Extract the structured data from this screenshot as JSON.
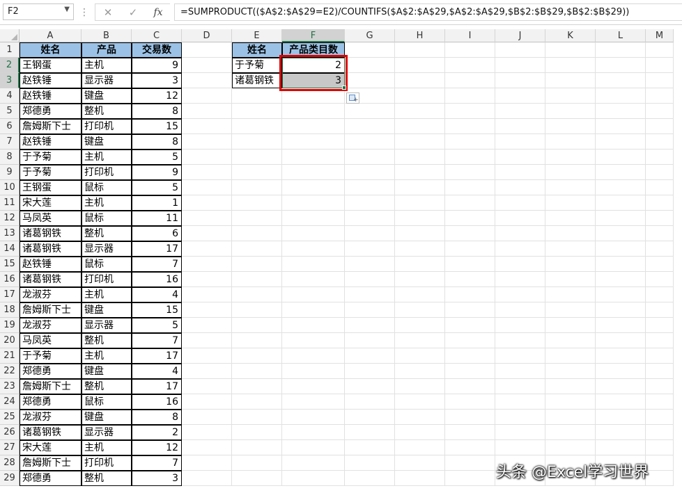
{
  "formula_bar": {
    "name_box": "F2",
    "cancel_glyph": "✕",
    "enter_glyph": "✓",
    "fx_label": "fx",
    "formula": "=SUMPRODUCT(($A$2:$A$29=E2)/COUNTIFS($A$2:$A$29,$A$2:$A$29,$B$2:$B$29,$B$2:$B$29))"
  },
  "columns": [
    "A",
    "B",
    "C",
    "D",
    "E",
    "F",
    "G",
    "H",
    "I",
    "J",
    "K",
    "L",
    "M"
  ],
  "rows": [
    "1",
    "2",
    "3",
    "4",
    "5",
    "6",
    "7",
    "8",
    "9",
    "10",
    "11",
    "12",
    "13",
    "14",
    "15",
    "16",
    "17",
    "18",
    "19",
    "20",
    "21",
    "22",
    "23",
    "24",
    "25",
    "26",
    "27",
    "28",
    "29"
  ],
  "table1": {
    "headers": [
      "姓名",
      "产品",
      "交易数"
    ],
    "data": [
      [
        "王钢蛋",
        "主机",
        "9"
      ],
      [
        "赵铁锤",
        "显示器",
        "3"
      ],
      [
        "赵铁锤",
        "键盘",
        "12"
      ],
      [
        "郑德勇",
        "整机",
        "8"
      ],
      [
        "詹姆斯下士",
        "打印机",
        "15"
      ],
      [
        "赵铁锤",
        "键盘",
        "8"
      ],
      [
        "于予菊",
        "主机",
        "5"
      ],
      [
        "于予菊",
        "打印机",
        "9"
      ],
      [
        "王钢蛋",
        "鼠标",
        "5"
      ],
      [
        "宋大莲",
        "主机",
        "1"
      ],
      [
        "马凤英",
        "鼠标",
        "11"
      ],
      [
        "诸葛钢铁",
        "整机",
        "6"
      ],
      [
        "诸葛钢铁",
        "显示器",
        "17"
      ],
      [
        "赵铁锤",
        "鼠标",
        "7"
      ],
      [
        "诸葛钢铁",
        "打印机",
        "16"
      ],
      [
        "龙淑芬",
        "主机",
        "4"
      ],
      [
        "詹姆斯下士",
        "键盘",
        "15"
      ],
      [
        "龙淑芬",
        "显示器",
        "5"
      ],
      [
        "马凤英",
        "整机",
        "7"
      ],
      [
        "于予菊",
        "主机",
        "17"
      ],
      [
        "郑德勇",
        "键盘",
        "4"
      ],
      [
        "詹姆斯下士",
        "整机",
        "17"
      ],
      [
        "郑德勇",
        "鼠标",
        "16"
      ],
      [
        "龙淑芬",
        "键盘",
        "8"
      ],
      [
        "诸葛钢铁",
        "显示器",
        "2"
      ],
      [
        "宋大莲",
        "主机",
        "12"
      ],
      [
        "詹姆斯下士",
        "打印机",
        "7"
      ],
      [
        "郑德勇",
        "整机",
        "3"
      ]
    ]
  },
  "table2": {
    "headers": [
      "姓名",
      "产品类目数"
    ],
    "data": [
      [
        "于予菊",
        "2"
      ],
      [
        "诸葛钢铁",
        "3"
      ]
    ]
  },
  "watermark": "头条 @Excel学习世界",
  "colors": {
    "header_fill": "#9bc2e6",
    "selection_red": "#e00000",
    "excel_green": "#217346",
    "selected_fill": "#c8c8c8"
  }
}
